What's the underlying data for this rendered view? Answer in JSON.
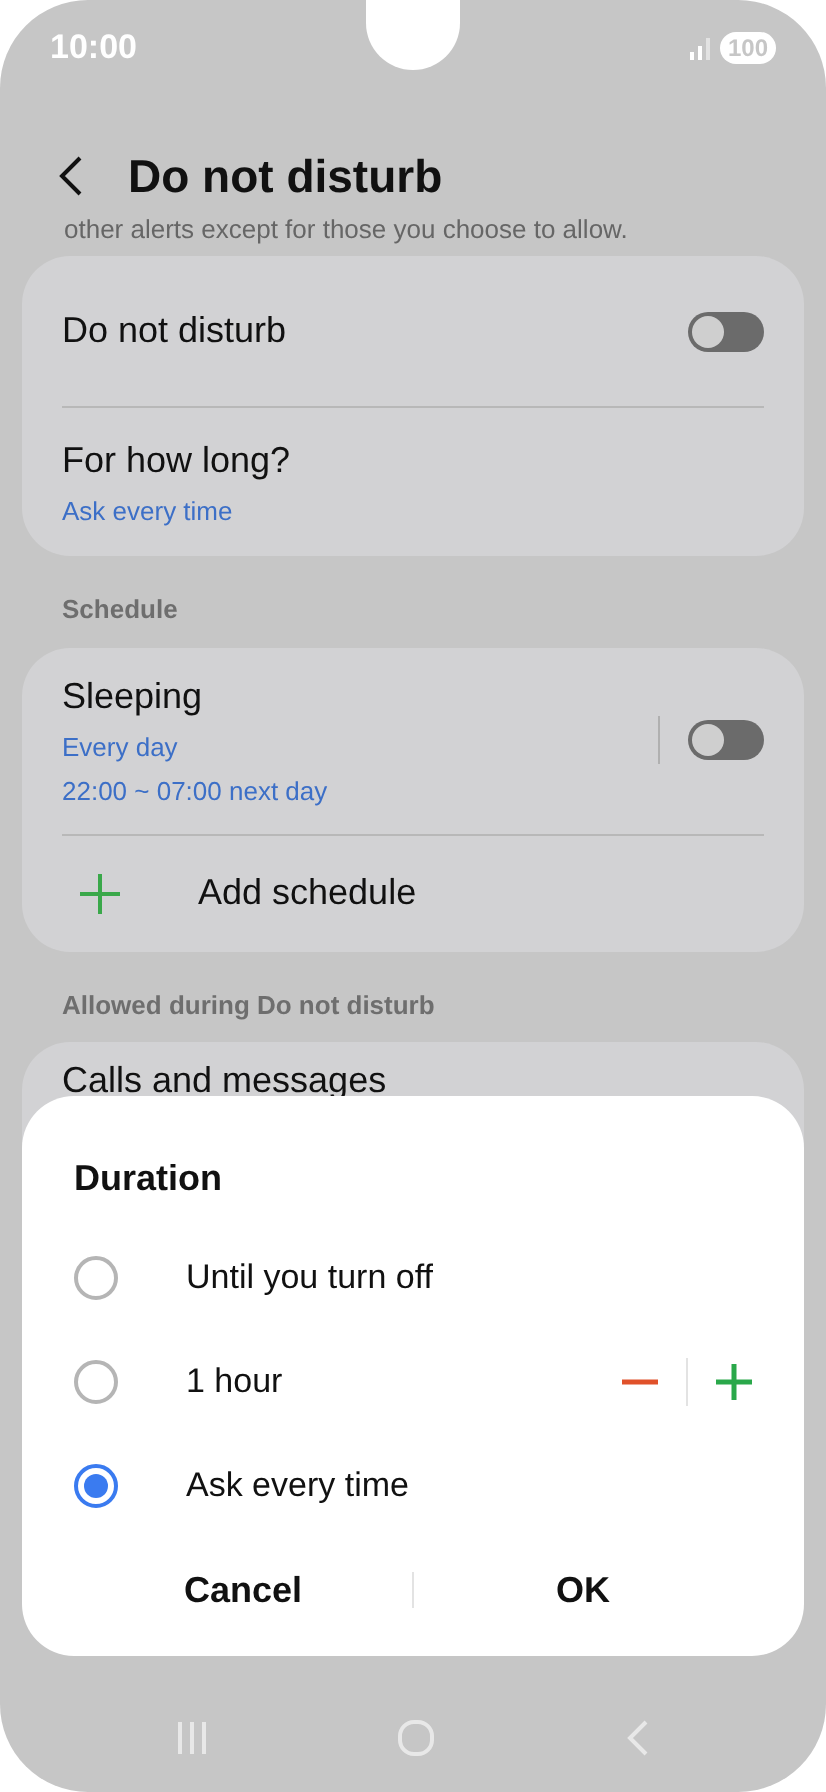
{
  "status_bar": {
    "time": "10:00",
    "battery": "100"
  },
  "header": {
    "title": "Do not disturb"
  },
  "intro": "other alerts except for those you choose to allow.",
  "main_card": {
    "toggle": {
      "label": "Do not disturb",
      "on": false
    },
    "duration": {
      "label": "For how long?",
      "value": "Ask every time"
    }
  },
  "schedule": {
    "heading": "Schedule",
    "items": [
      {
        "name": "Sleeping",
        "days": "Every day",
        "time": "22:00 ~ 07:00 next day",
        "on": false
      }
    ],
    "add_label": "Add schedule"
  },
  "allowed": {
    "heading": "Allowed during Do not disturb",
    "items": [
      "Calls and messages"
    ]
  },
  "dialog": {
    "title": "Duration",
    "options": [
      {
        "label": "Until you turn off",
        "selected": false,
        "kind": "plain"
      },
      {
        "label": "1 hour",
        "selected": false,
        "kind": "stepper"
      },
      {
        "label": "Ask every time",
        "selected": true,
        "kind": "plain"
      }
    ],
    "buttons": [
      "Cancel",
      "OK"
    ]
  }
}
